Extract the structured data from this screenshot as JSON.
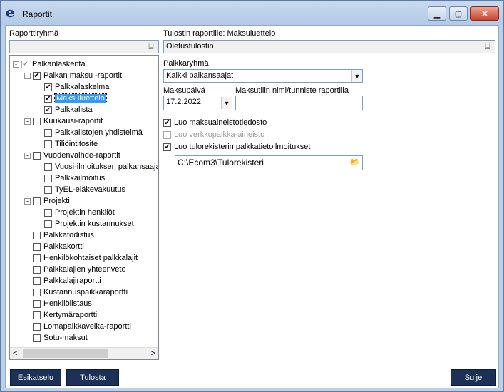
{
  "window": {
    "title": "Raportit",
    "app_icon_glyph": "e",
    "minimize_glyph": "▁",
    "maximize_glyph": "▢",
    "close_glyph": "✕"
  },
  "left": {
    "group_label": "Raporttiryhmä",
    "group_value": ""
  },
  "right": {
    "printer_label": "Tulostin raportille: Maksuluettelo",
    "printer_value": "Oletustulostin",
    "group_label": "Palkkaryhmä",
    "group_value": "Kaikki palkansaajat",
    "date_label": "Maksupäivä",
    "date_value": "17.2.2022",
    "account_label": "Maksutilin nimi/tunniste raportilla",
    "account_value": "",
    "chk_maksuaineisto": "Luo maksuaineistotiedosto",
    "chk_verkkopalkka": "Luo verkkopalkka-aineisto",
    "chk_tulorekisteri": "Luo tulorekisterin palkkatietoilmoitukset",
    "tulorekisteri_path": "C:\\Ecom3\\Tulorekisteri"
  },
  "tree": [
    {
      "label": "Palkanlaskenta",
      "level": 0,
      "expander": "-",
      "checked": "gray"
    },
    {
      "label": "Palkan maksu -raportit",
      "level": 1,
      "expander": "-",
      "checked": "yes"
    },
    {
      "label": "Palkkalaskelma",
      "level": 2,
      "expander": "",
      "checked": "yes"
    },
    {
      "label": "Maksuluettelo",
      "level": 2,
      "expander": "",
      "checked": "yes",
      "selected": true
    },
    {
      "label": "Palkkalista",
      "level": 2,
      "expander": "",
      "checked": "yes"
    },
    {
      "label": "Kuukausi-raportit",
      "level": 1,
      "expander": "-",
      "checked": "no"
    },
    {
      "label": "Palkkalistojen yhdistelmä",
      "level": 2,
      "expander": "",
      "checked": "no"
    },
    {
      "label": "Tiliöintitosite",
      "level": 2,
      "expander": "",
      "checked": "no"
    },
    {
      "label": "Vuodenvaihde-raportit",
      "level": 1,
      "expander": "-",
      "checked": "no"
    },
    {
      "label": "Vuosi-ilmoituksen palkansaaja",
      "level": 2,
      "expander": "",
      "checked": "no"
    },
    {
      "label": "Palkkailmoitus",
      "level": 2,
      "expander": "",
      "checked": "no"
    },
    {
      "label": "TyEL-eläkevakuutus",
      "level": 2,
      "expander": "",
      "checked": "no"
    },
    {
      "label": "Projekti",
      "level": 1,
      "expander": "-",
      "checked": "no"
    },
    {
      "label": "Projektin henkilöt",
      "level": 2,
      "expander": "",
      "checked": "no"
    },
    {
      "label": "Projektin kustannukset",
      "level": 2,
      "expander": "",
      "checked": "no"
    },
    {
      "label": "Palkkatodistus",
      "level": 1,
      "expander": "",
      "checked": "no"
    },
    {
      "label": "Palkkakortti",
      "level": 1,
      "expander": "",
      "checked": "no"
    },
    {
      "label": "Henkilökohtaiset palkkalajit",
      "level": 1,
      "expander": "",
      "checked": "no"
    },
    {
      "label": "Palkkalajien yhteenveto",
      "level": 1,
      "expander": "",
      "checked": "no"
    },
    {
      "label": "Palkkalajiraportti",
      "level": 1,
      "expander": "",
      "checked": "no"
    },
    {
      "label": "Kustannuspaikkaraportti",
      "level": 1,
      "expander": "",
      "checked": "no"
    },
    {
      "label": "Henkilölistaus",
      "level": 1,
      "expander": "",
      "checked": "no"
    },
    {
      "label": "Kertymäraportti",
      "level": 1,
      "expander": "",
      "checked": "no"
    },
    {
      "label": "Lomapalkkavelka-raportti",
      "level": 1,
      "expander": "",
      "checked": "no"
    },
    {
      "label": "Sotu-maksut",
      "level": 1,
      "expander": "",
      "checked": "no"
    }
  ],
  "buttons": {
    "preview": "Esikatselu",
    "print": "Tulosta",
    "close": "Sulje"
  },
  "glyphs": {
    "check": "✔",
    "dropdown": "▼",
    "picker": "⌸",
    "folder": "📂",
    "scroll_left": "<",
    "scroll_right": ">"
  }
}
